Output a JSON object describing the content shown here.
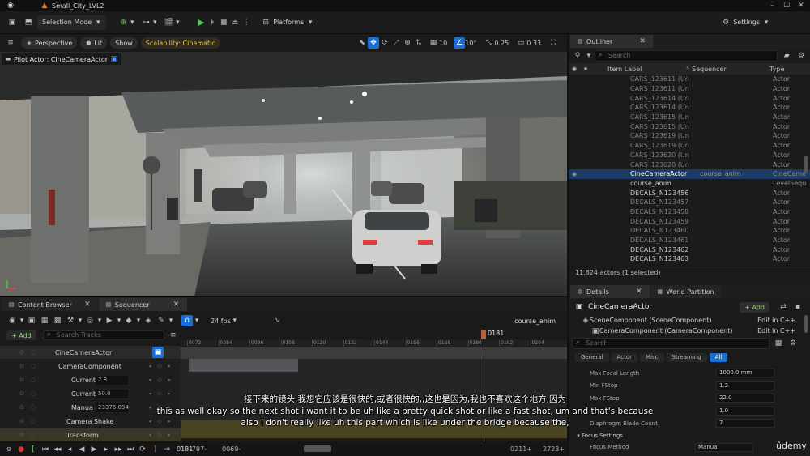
{
  "window": {
    "level_name": "Small_City_LVL2"
  },
  "toolbar": {
    "selection_mode": "Selection Mode",
    "platforms": "Platforms",
    "settings": "Settings"
  },
  "viewport_bar": {
    "perspective": "Perspective",
    "lit": "Lit",
    "show": "Show",
    "scalability": "Scalability: Cinematic",
    "grid_value": "10",
    "angle_value": "10°",
    "scale_value": "0.25",
    "camera_speed": "0.33"
  },
  "viewport": {
    "pilot_label": "Pilot Actor: CineCameraActor"
  },
  "outliner": {
    "tab_label": "Outliner",
    "search_placeholder": "Search",
    "col_item_label": "Item Label",
    "col_sequencer": "Sequencer",
    "col_type": "Type",
    "rows": [
      {
        "label": "CARS_123611 (Un",
        "sequencer": "",
        "type": "Actor",
        "dim": true
      },
      {
        "label": "CARS_123611 (Un",
        "sequencer": "",
        "type": "Actor",
        "dim": true
      },
      {
        "label": "CARS_123614 (Un",
        "sequencer": "",
        "type": "Actor",
        "dim": true
      },
      {
        "label": "CARS_123614 (Un",
        "sequencer": "",
        "type": "Actor",
        "dim": true
      },
      {
        "label": "CARS_123615 (Un",
        "sequencer": "",
        "type": "Actor",
        "dim": true
      },
      {
        "label": "CARS_123615 (Un",
        "sequencer": "",
        "type": "Actor",
        "dim": true
      },
      {
        "label": "CARS_123619 (Un",
        "sequencer": "",
        "type": "Actor",
        "dim": true
      },
      {
        "label": "CARS_123619 (Un",
        "sequencer": "",
        "type": "Actor",
        "dim": true
      },
      {
        "label": "CARS_123620 (Un",
        "sequencer": "",
        "type": "Actor",
        "dim": true
      },
      {
        "label": "CARS_123620 (Un",
        "sequencer": "",
        "type": "Actor",
        "dim": true
      },
      {
        "label": "CineCameraActor",
        "sequencer": "course_anim",
        "type": "CineCame",
        "selected": true
      },
      {
        "label": "course_anim",
        "sequencer": "",
        "type": "LevelSequ",
        "dim": false
      },
      {
        "label": "DECALS_N123456",
        "sequencer": "",
        "type": "Actor",
        "dim": false
      },
      {
        "label": "DECALS_N123457",
        "sequencer": "",
        "type": "Actor",
        "dim": true
      },
      {
        "label": "DECALS_N123458",
        "sequencer": "",
        "type": "Actor",
        "dim": true
      },
      {
        "label": "DECALS_N123459",
        "sequencer": "",
        "type": "Actor",
        "dim": true
      },
      {
        "label": "DECALS_N123460",
        "sequencer": "",
        "type": "Actor",
        "dim": true
      },
      {
        "label": "DECALS_N123461",
        "sequencer": "",
        "type": "Actor",
        "dim": true
      },
      {
        "label": "DECALS_N123462",
        "sequencer": "",
        "type": "Actor",
        "dim": false
      },
      {
        "label": "DECALS_N123463",
        "sequencer": "",
        "type": "Actor",
        "dim": false
      }
    ],
    "status": "11,824 actors (1 selected)"
  },
  "details": {
    "tab_details": "Details",
    "tab_world_partition": "World Partition",
    "actor_name": "CineCameraActor",
    "add_label": "+ Add",
    "components": [
      {
        "name": "SceneComponent (SceneComponent)",
        "action": "Edit in C++"
      },
      {
        "name": "CameraComponent (CameraComponent)",
        "action": "Edit in C++"
      }
    ],
    "search_placeholder": "Search",
    "filters": [
      "General",
      "Actor",
      "Misc",
      "Streaming",
      "All"
    ],
    "properties": [
      {
        "label": "Max Focal Length",
        "value": "1000.0 mm"
      },
      {
        "label": "Min FStop",
        "value": "1.2"
      },
      {
        "label": "Max FStop",
        "value": "22.0"
      },
      {
        "label": "",
        "value": "1.0"
      },
      {
        "label": "Diaphragm Blade Count",
        "value": "7"
      }
    ],
    "focus_section": "Focus Settings",
    "focus_method_label": "Focus Method",
    "focus_method_value": "Manual"
  },
  "bottom": {
    "tab_content_browser": "Content Browser",
    "tab_sequencer": "Sequencer",
    "fps": "24 fps",
    "sequence_name": "course_anim",
    "add_label": "+ Add",
    "search_tracks": "Search Tracks",
    "playhead_frame": "0181",
    "ruler_ticks": [
      "0072",
      "0084",
      "0096",
      "0108",
      "0120",
      "0132",
      "0144",
      "0156",
      "0168",
      "0180",
      "0192",
      "0204"
    ],
    "tracks": [
      {
        "name": "CineCameraActor",
        "value": ""
      },
      {
        "name": "CameraComponent",
        "value": ""
      },
      {
        "name": "Current",
        "value": "2.8"
      },
      {
        "name": "Current",
        "value": "50.0"
      },
      {
        "name": "Manua",
        "value": "23376.894"
      },
      {
        "name": "Camera Shake",
        "value": ""
      },
      {
        "name": "Transform",
        "value": ""
      }
    ],
    "transport_frame": "0181",
    "range_start": "-797-",
    "range_in": "0069-",
    "range_out": "0211+",
    "range_end": "2723+"
  },
  "subtitles": {
    "line_cn": "接下来的镜头,我想它应该是很快的,或者很快的,,这也是因为,我也不喜欢这个地方,因为",
    "line_en1": "this as well okay so the next shot i want it to be uh like a pretty quick shot or like a fast shot, um and that's because",
    "line_en2": "also i don't really like uh this part which is like under the bridge because the,"
  },
  "watermark": "ûdemy",
  "colors": {
    "accent_blue": "#1b6fd1",
    "selection": "#1b3b67",
    "cinematic_yellow": "#e6c84a",
    "keyframe_red": "#c0392b"
  }
}
